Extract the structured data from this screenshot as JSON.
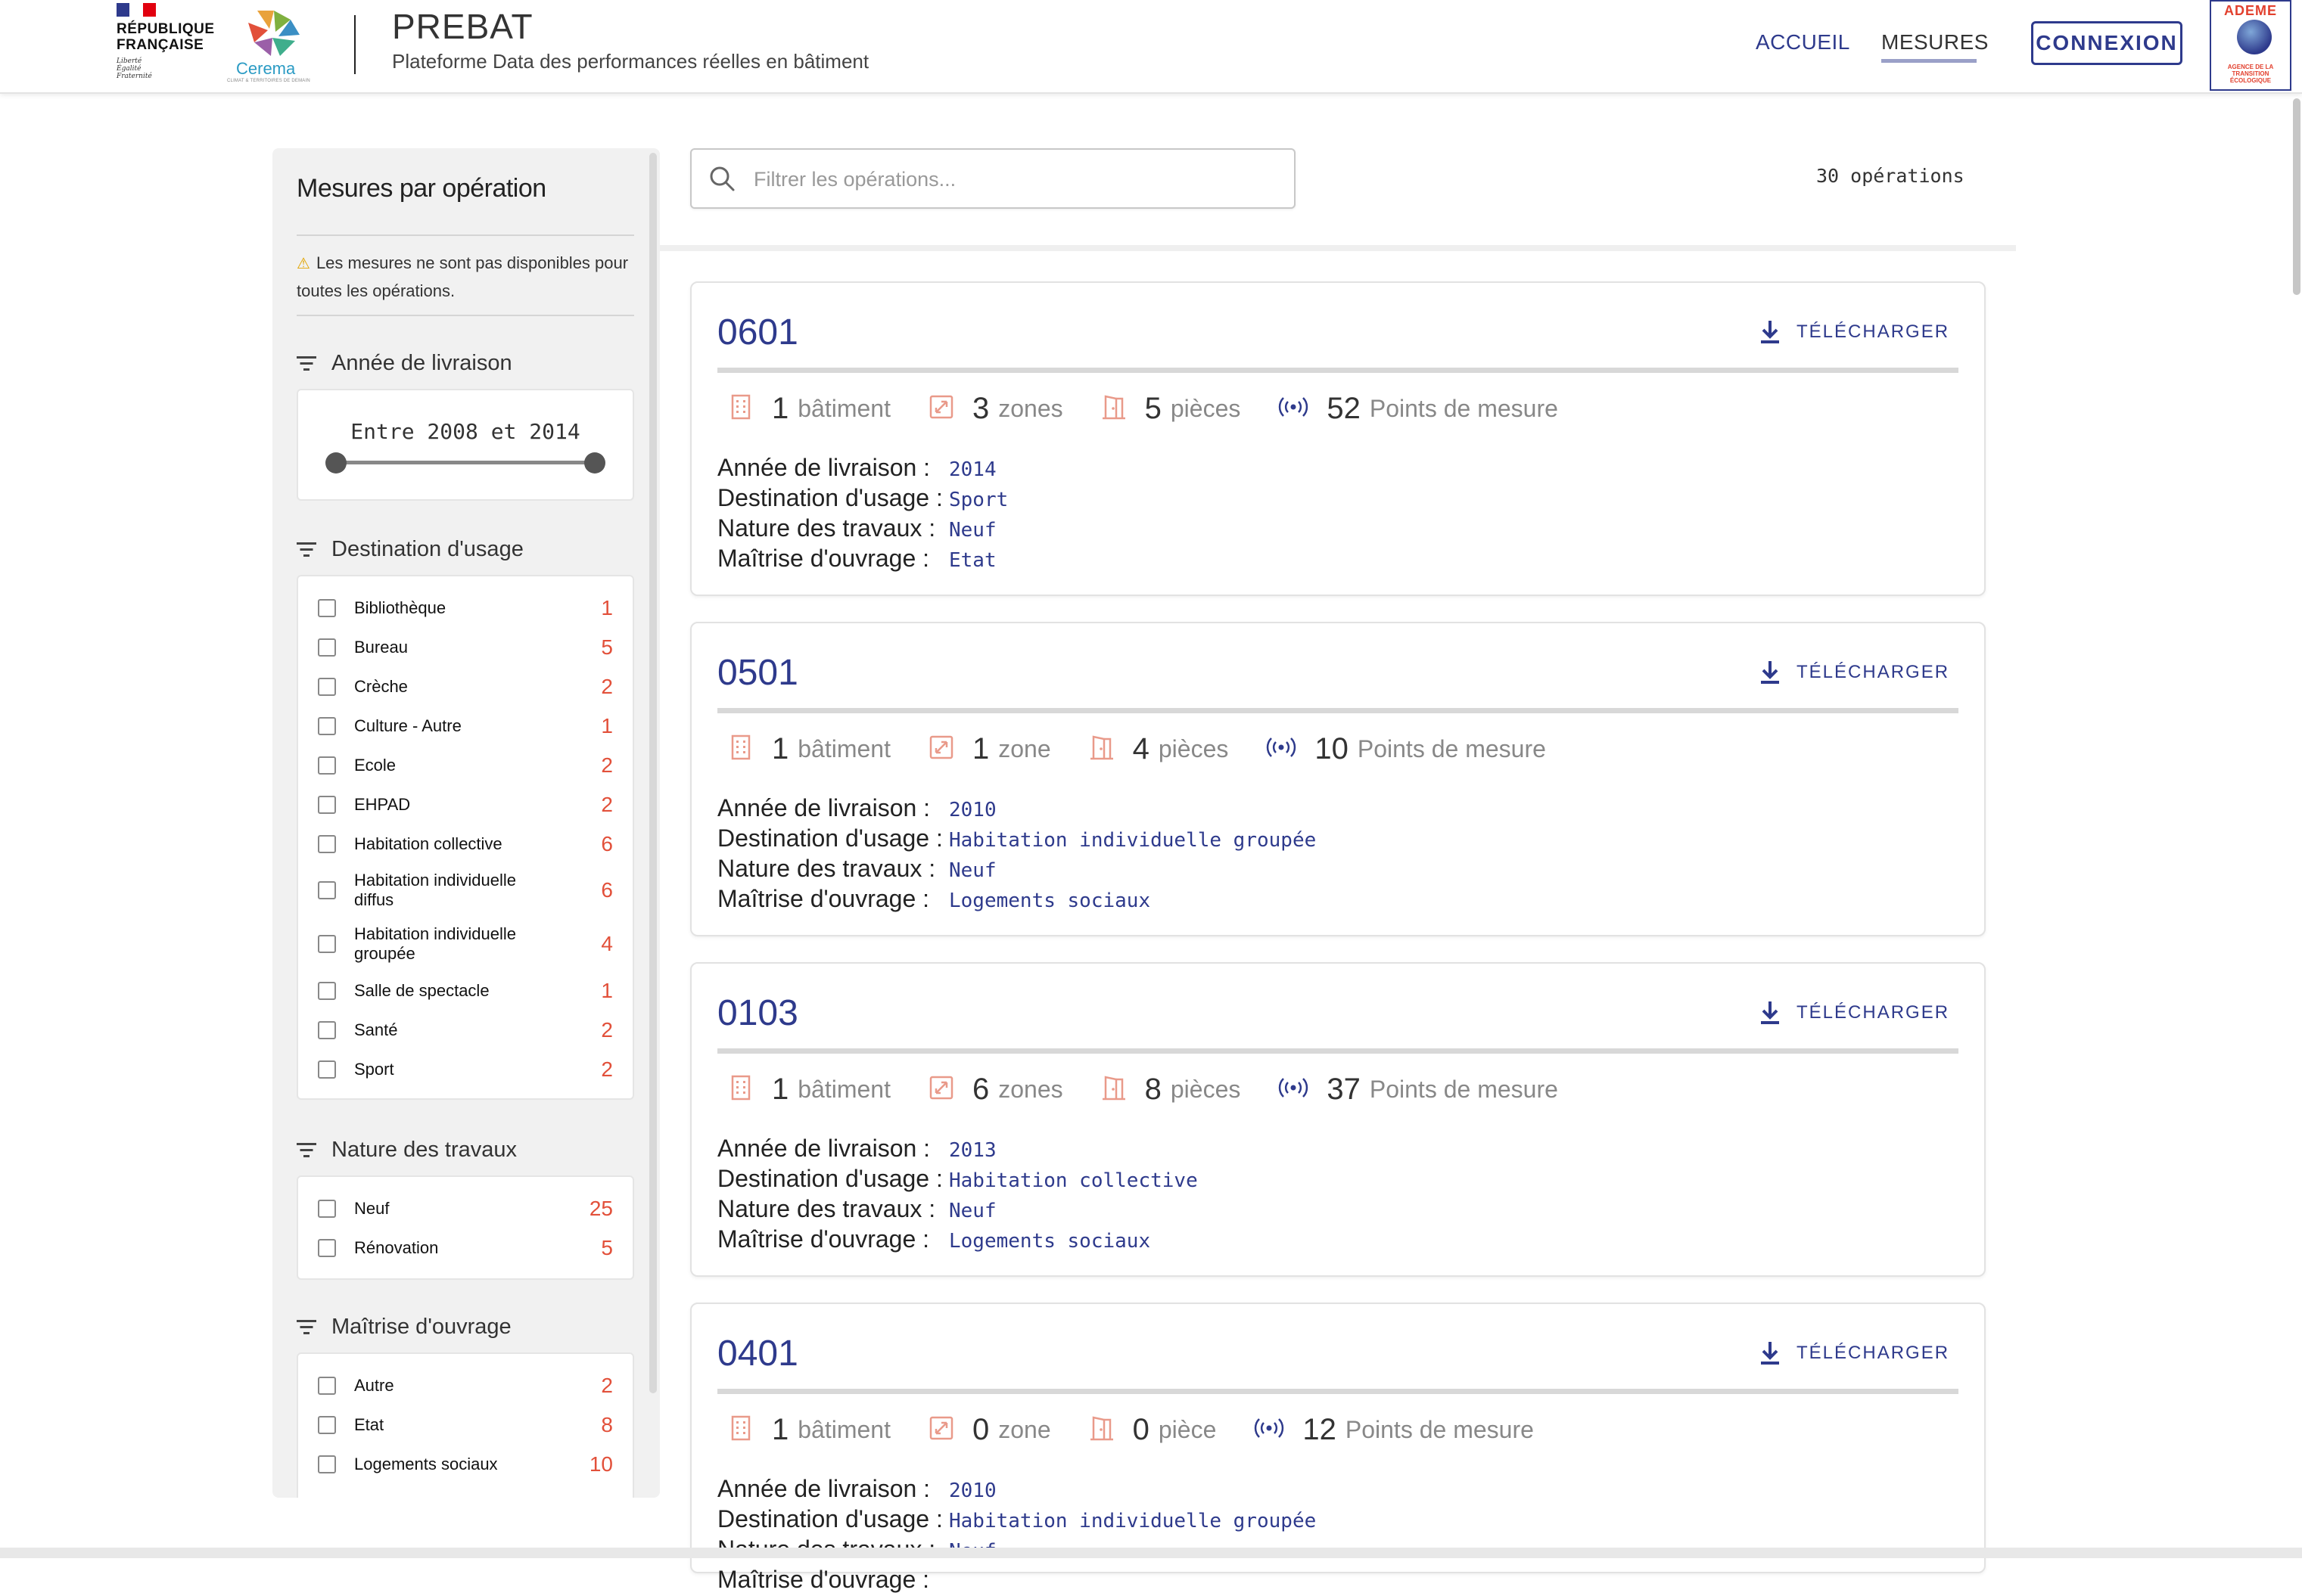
{
  "header": {
    "republique_line1": "RÉPUBLIQUE",
    "republique_line2": "FRANÇAISE",
    "motto_1": "Liberté",
    "motto_2": "Égalité",
    "motto_3": "Fraternité",
    "cerema_name": "Cerema",
    "cerema_tagline": "CLIMAT & TERRITOIRES DE DEMAIN",
    "app_title": "PREBAT",
    "app_subtitle": "Plateforme Data des performances réelles en bâtiment",
    "nav": {
      "accueil": "ACCUEIL",
      "mesures": "MESURES"
    },
    "connexion_label": "CONNEXION",
    "ademe_title": "ADEME",
    "ademe_sub": "AGENCE DE LA TRANSITION ÉCOLOGIQUE"
  },
  "sidebar": {
    "title": "Mesures par opération",
    "note_icon": "warning-icon",
    "note": "Les mesures ne sont pas disponibles pour toutes les opérations.",
    "year_filter": {
      "title": "Année de livraison",
      "range_text": "Entre 2008 et 2014",
      "min": 2008,
      "max": 2014
    },
    "destination_filter": {
      "title": "Destination d'usage",
      "items": [
        {
          "label": "Bibliothèque",
          "count": "1"
        },
        {
          "label": "Bureau",
          "count": "5"
        },
        {
          "label": "Crèche",
          "count": "2"
        },
        {
          "label": "Culture - Autre",
          "count": "1"
        },
        {
          "label": "Ecole",
          "count": "2"
        },
        {
          "label": "EHPAD",
          "count": "2"
        },
        {
          "label": "Habitation collective",
          "count": "6"
        },
        {
          "label": "Habitation individuelle diffus",
          "count": "6"
        },
        {
          "label": "Habitation individuelle groupée",
          "count": "4"
        },
        {
          "label": "Salle de spectacle",
          "count": "1"
        },
        {
          "label": "Santé",
          "count": "2"
        },
        {
          "label": "Sport",
          "count": "2"
        }
      ]
    },
    "nature_filter": {
      "title": "Nature des travaux",
      "items": [
        {
          "label": "Neuf",
          "count": "25"
        },
        {
          "label": "Rénovation",
          "count": "5"
        }
      ]
    },
    "maitrise_filter": {
      "title": "Maîtrise d'ouvrage",
      "items": [
        {
          "label": "Autre",
          "count": "2"
        },
        {
          "label": "Etat",
          "count": "8"
        },
        {
          "label": "Logements sociaux",
          "count": "10"
        }
      ]
    }
  },
  "search": {
    "placeholder": "Filtrer les opérations..."
  },
  "operations_count": "30 opérations",
  "detail_labels": {
    "annee": "Année de livraison :",
    "destination": "Destination d'usage :",
    "nature": "Nature des travaux :",
    "maitrise": "Maîtrise d'ouvrage :"
  },
  "download_label": "TÉLÉCHARGER",
  "cards": [
    {
      "id": "0601",
      "batiments": {
        "num": "1",
        "unit": "bâtiment"
      },
      "zones": {
        "num": "3",
        "unit": "zones"
      },
      "pieces": {
        "num": "5",
        "unit": "pièces"
      },
      "points": {
        "num": "52",
        "unit": "Points de mesure"
      },
      "annee": "2014",
      "destination": "Sport",
      "nature": "Neuf",
      "maitrise": "Etat"
    },
    {
      "id": "0501",
      "batiments": {
        "num": "1",
        "unit": "bâtiment"
      },
      "zones": {
        "num": "1",
        "unit": "zone"
      },
      "pieces": {
        "num": "4",
        "unit": "pièces"
      },
      "points": {
        "num": "10",
        "unit": "Points de mesure"
      },
      "annee": "2010",
      "destination": "Habitation individuelle groupée",
      "nature": "Neuf",
      "maitrise": "Logements sociaux"
    },
    {
      "id": "0103",
      "batiments": {
        "num": "1",
        "unit": "bâtiment"
      },
      "zones": {
        "num": "6",
        "unit": "zones"
      },
      "pieces": {
        "num": "8",
        "unit": "pièces"
      },
      "points": {
        "num": "37",
        "unit": "Points de mesure"
      },
      "annee": "2013",
      "destination": "Habitation collective",
      "nature": "Neuf",
      "maitrise": "Logements sociaux"
    },
    {
      "id": "0401",
      "batiments": {
        "num": "1",
        "unit": "bâtiment"
      },
      "zones": {
        "num": "0",
        "unit": "zone"
      },
      "pieces": {
        "num": "0",
        "unit": "pièce"
      },
      "points": {
        "num": "12",
        "unit": "Points de mesure"
      },
      "annee": "2010",
      "destination": "Habitation individuelle groupée",
      "nature": "Neuf",
      "maitrise": ""
    }
  ],
  "colors": {
    "primary": "#2e3a8c",
    "accent": "#e2503a"
  }
}
